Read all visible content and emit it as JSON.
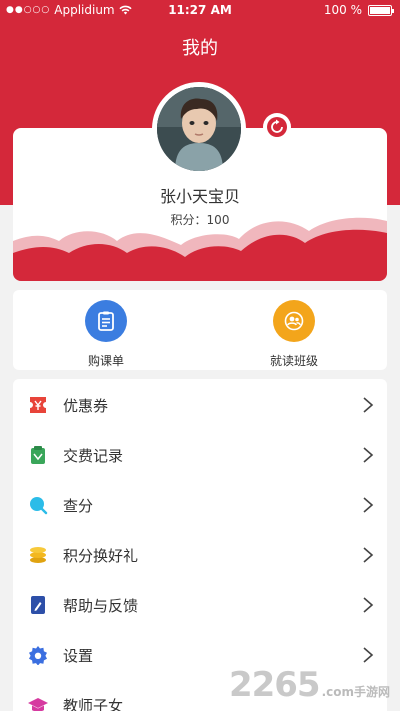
{
  "status_bar": {
    "carrier": "Applidium",
    "time": "11:27 AM",
    "battery": "100 %"
  },
  "header": {
    "title": "我的"
  },
  "profile": {
    "name": "张小天宝贝",
    "points": "积分：100"
  },
  "quick_actions": [
    {
      "label": "购课单",
      "icon": "clipboard-icon",
      "color": "#3b7de0"
    },
    {
      "label": "就读班级",
      "icon": "people-icon",
      "color": "#f3a51b"
    }
  ],
  "menu": [
    {
      "label": "优惠券",
      "icon": "coupon-icon"
    },
    {
      "label": "交费记录",
      "icon": "receipt-icon"
    },
    {
      "label": "查分",
      "icon": "search-icon"
    },
    {
      "label": "积分换好礼",
      "icon": "coins-icon"
    },
    {
      "label": "帮助与反馈",
      "icon": "feedback-icon"
    },
    {
      "label": "设置",
      "icon": "gear-icon"
    },
    {
      "label": "教师子女",
      "icon": "graduation-cap-icon"
    }
  ],
  "watermark": {
    "number": "2265",
    "text": ".com手游网"
  },
  "colors": {
    "brand_red": "#d4283a",
    "wave_pink": "#f0b7bd"
  }
}
